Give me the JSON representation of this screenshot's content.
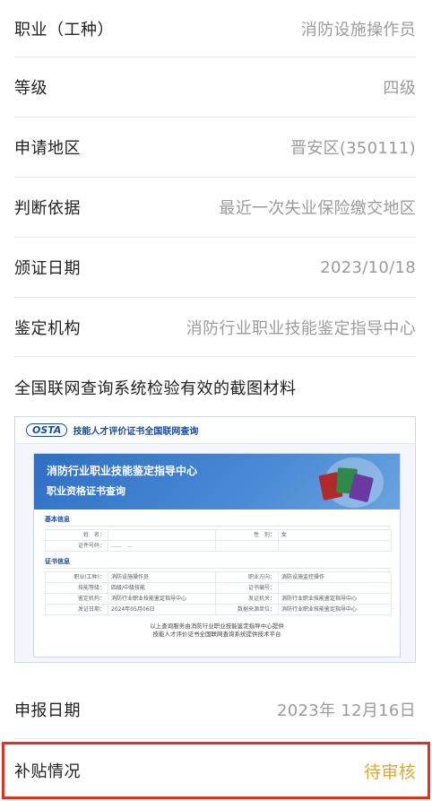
{
  "rows": [
    {
      "label": "职业（工种）",
      "value": "消防设施操作员"
    },
    {
      "label": "等级",
      "value": "四级"
    },
    {
      "label": "申请地区",
      "value": "晋安区(350111)"
    },
    {
      "label": "判断依据",
      "value": "最近一次失业保险缴交地区"
    },
    {
      "label": "颁证日期",
      "value": "2023/10/18"
    },
    {
      "label": "鉴定机构",
      "value": "消防行业职业技能鉴定指导中心"
    }
  ],
  "screenshot_section": {
    "title": "全国联网查询系统检验有效的截图材料"
  },
  "certificate_image": {
    "logo": "OSTA",
    "top_title": "技能人才评价证书全国联网查询",
    "header_line1": "消防行业职业技能鉴定指导中心",
    "header_line2": "职业资格证书查询",
    "basic_section": "基本信息",
    "basic_fields": [
      {
        "k": "姓　名：",
        "v": "",
        "k2": "性　别：",
        "v2": "女"
      },
      {
        "k": "证件号码：",
        "v": "……　…",
        "k2": "",
        "v2": ""
      }
    ],
    "cert_section": "证书信息",
    "cert_fields": [
      {
        "k": "职业(工种)：",
        "v": "消防设施操作员",
        "k2": "职业方向：",
        "v2": "消防设施监控操作"
      },
      {
        "k": "技能等级：",
        "v": "四级/中级技能",
        "k2": "证书编号：",
        "v2": ""
      },
      {
        "k": "鉴定机构：",
        "v": "消防行业职业技能鉴定指导中心",
        "k2": "发证机关：",
        "v2": "消防行业职业技能鉴定指导中心"
      },
      {
        "k": "发证日期：",
        "v": "2024年05月06日",
        "k2": "数据来源单位：",
        "v2": "消防行业职业技能鉴定指导中心"
      }
    ],
    "footer_line1": "以上查询服务由消防行业职业技能鉴定指导中心提供",
    "footer_line2": "技能人才评价证书全国联网查询系统提供技术平台"
  },
  "report_date": {
    "label": "申报日期",
    "value": "2023年 12月16日"
  },
  "subsidy": {
    "label": "补贴情况",
    "value": "待审核"
  },
  "colors": {
    "pending": "#d9a93a",
    "highlight_border": "#e2301f",
    "value_gray": "#9b9b9b"
  }
}
